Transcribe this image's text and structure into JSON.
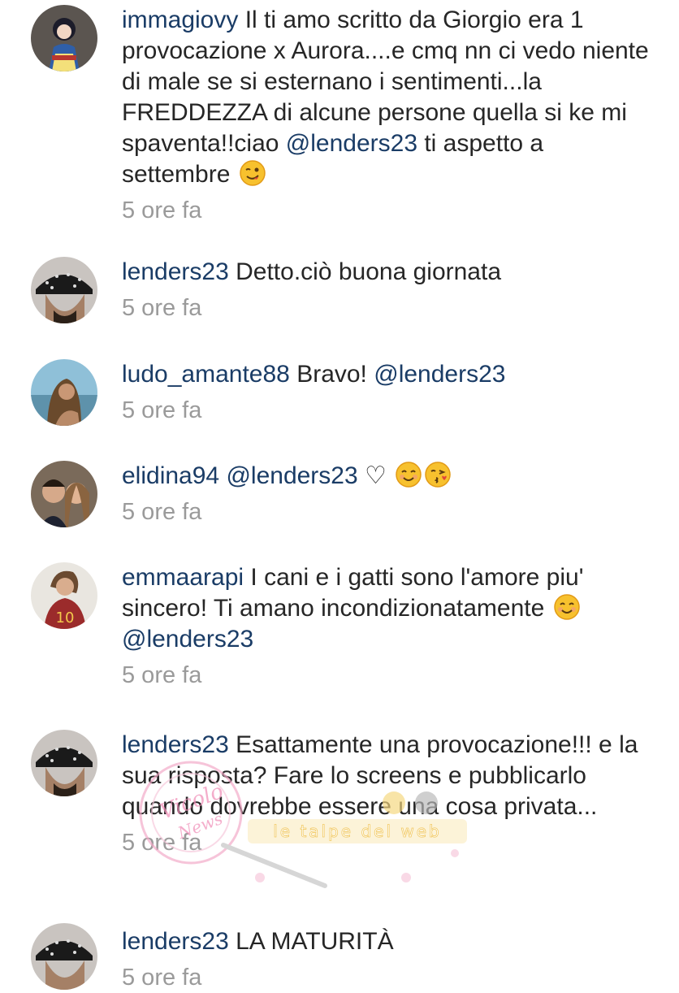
{
  "comments": [
    {
      "username": "immagiovy",
      "text": "Il ti amo scritto da Giorgio era 1 provocazione x Aurora....e cmq nn ci vedo niente  di male se si esternano i sentimenti...la FREDDEZZA di alcune persone quella si ke mi spaventa!!ciao ",
      "mention": "@lenders23",
      "text_after": " ti aspetto a settembre",
      "emoji": "winking-face-emoji",
      "time": "5 ore fa"
    },
    {
      "username": "lenders23",
      "text": "Detto.ciò buona giornata",
      "time": "5 ore fa"
    },
    {
      "username": "ludo_amante88",
      "text": "Bravo! ",
      "mention": "@lenders23",
      "time": "5 ore fa"
    },
    {
      "username": "elidina94",
      "mention": "@lenders23",
      "text_after": " ♡",
      "emoji": "smiling-face-emoji",
      "emoji2": "kissing-face-emoji",
      "time": "5 ore fa"
    },
    {
      "username": "emmaarapi",
      "text": "I cani e i gatti sono l'amore piu' sincero! Ti amano incondizionatamente ",
      "emoji": "smiling-face-emoji",
      "mention": "@lenders23",
      "time": "5 ore fa"
    },
    {
      "username": "lenders23",
      "text": "Esattamente una provocazione!!! e la sua risposta? Fare lo screens e pubblicarlo quando dovrebbe essere una cosa privata...",
      "time": "5 ore fa"
    },
    {
      "username": "lenders23",
      "text": "LA MATURITÀ",
      "time": "5 ore fa"
    }
  ],
  "watermark": {
    "script_text": "Vicolo delle News",
    "caption": "le talpe del web"
  },
  "colors": {
    "username": "#1a3c66",
    "text": "#262626",
    "time": "#9a9a9a",
    "emoji_yellow": "#f7c12e"
  }
}
